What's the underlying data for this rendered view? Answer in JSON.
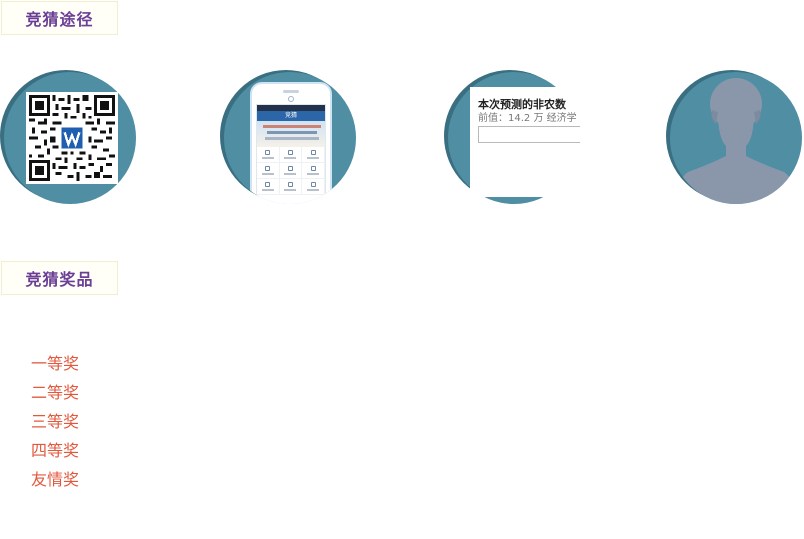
{
  "sections": {
    "ways_title": "竞猜途径",
    "prizes_title": "竞猜奖品"
  },
  "ways": [
    {
      "name": "qr-code"
    },
    {
      "name": "mobile-app",
      "screen_title": "竞猜"
    },
    {
      "name": "web-survey",
      "question": "本次预测的非农数",
      "previous": "前值：14.2 万   经济学"
    },
    {
      "name": "user-avatar"
    }
  ],
  "prizes": [
    "一等奖",
    "二等奖",
    "三等奖",
    "四等奖",
    "友情奖"
  ],
  "colors": {
    "header_text": "#6b3f96",
    "prize_text": "#e2583d",
    "circle": "#4f8ea3"
  }
}
